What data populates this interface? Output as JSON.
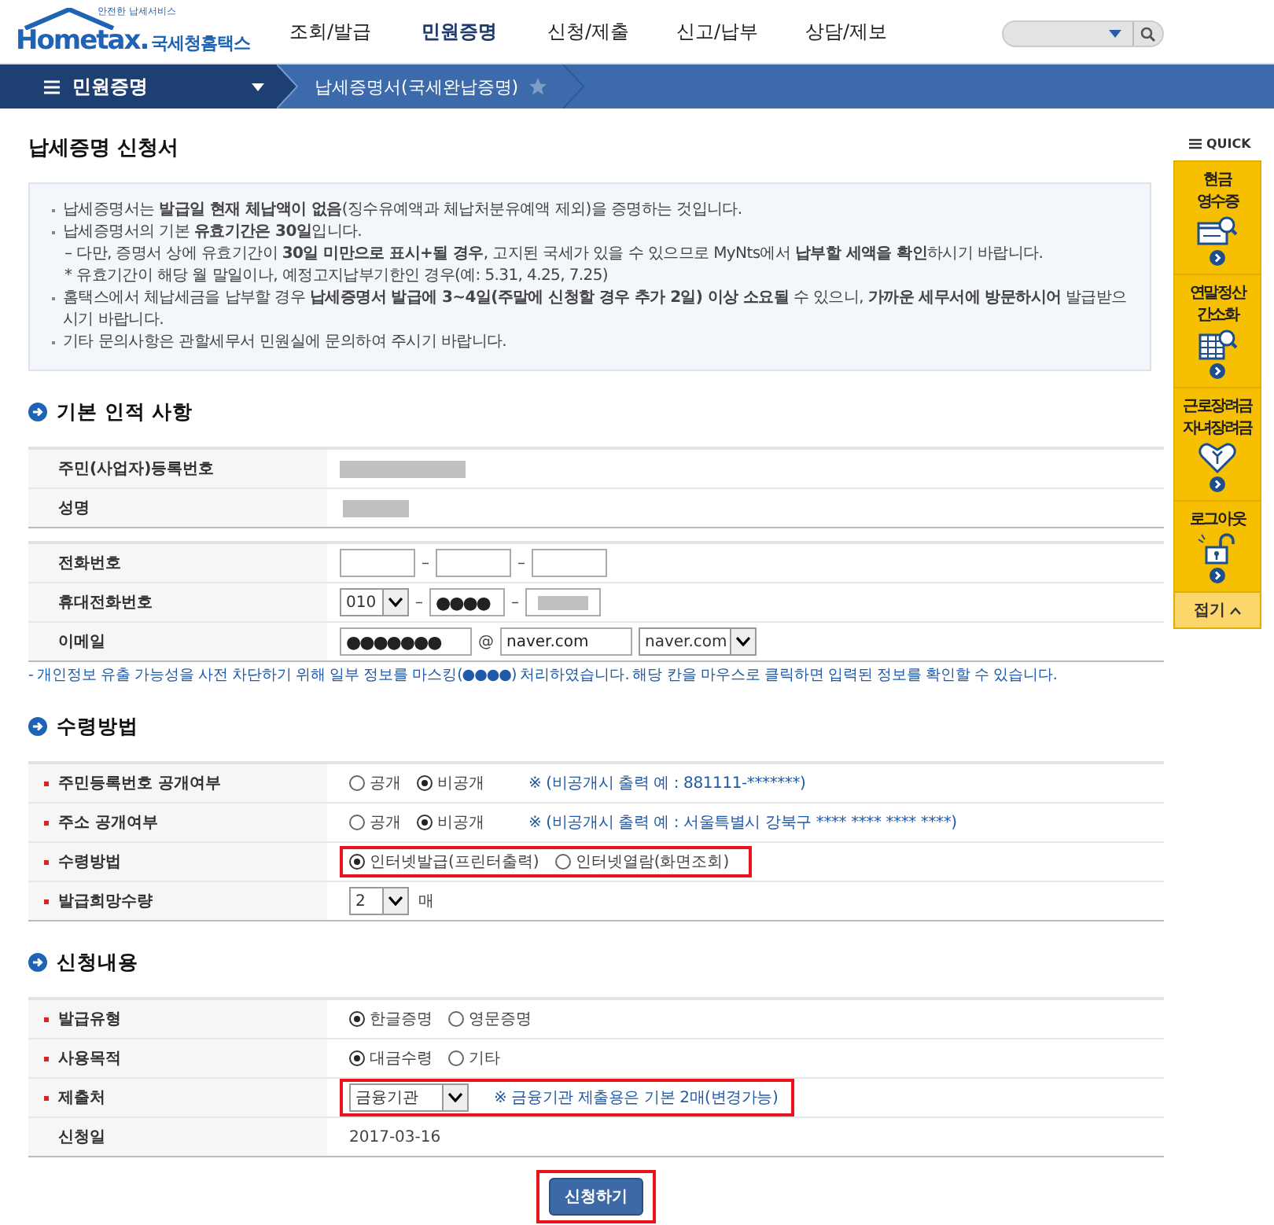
{
  "header": {
    "logo": {
      "tagline": "안전한 납세서비스",
      "brand": "Hometax.",
      "brand_kr": "국세청홈택스"
    },
    "nav": [
      {
        "label": "조회/발급",
        "selected": false
      },
      {
        "label": "민원증명",
        "selected": true
      },
      {
        "label": "신청/제출",
        "selected": false
      },
      {
        "label": "신고/납부",
        "selected": false
      },
      {
        "label": "상담/제보",
        "selected": false
      }
    ]
  },
  "breadcrumb": {
    "menu": "민원증명",
    "current": "납세증명서(국세완납증명)"
  },
  "page_title": "납세증명 신청서",
  "notice": [
    {
      "kind": "bullet",
      "text": "납세증명서는 **발급일 현재 체납액이 없음**(징수유예액과 체납처분유예액 제외)을 증명하는 것입니다."
    },
    {
      "kind": "bullet",
      "text": "납세증명서의 기본 **유효기간은 30일**입니다."
    },
    {
      "kind": "sub",
      "text": "– 다만, 증명서 상에 유효기간이 **30일 미만으로 표시+될 경우**, 고지된 국세가 있을 수 있으므로 MyNts에서 **납부할 세액을 확인**하시기 바랍니다."
    },
    {
      "kind": "sub",
      "text": "* 유효기간이 해당 월 말일이나, 예정고지납부기한인 경우(예: 5.31, 4.25, 7.25)"
    },
    {
      "kind": "bullet",
      "text": "홈택스에서 체납세금을 납부할 경우 **납세증명서 발급에 3~4일(주말에 신청할 경우 추가 2일) 이상 소요될** 수 있으니, **가까운 세무서에 방문하시어** 발급받으시기 바랍니다."
    },
    {
      "kind": "bullet",
      "text": "기타 문의사항은 관할세무서 민원실에 문의하여 주시기 바랍니다."
    }
  ],
  "sections": [
    {
      "title": "기본 인적 사항",
      "groups": [
        {
          "rows": [
            {
              "kind": "masked_long",
              "required": false,
              "label": "주민(사업자)등록번호"
            },
            {
              "kind": "masked_short",
              "required": false,
              "label": "성명"
            }
          ]
        },
        {
          "rows": [
            {
              "kind": "phone",
              "required": false,
              "label": "전화번호",
              "separator": "–"
            },
            {
              "kind": "mobile",
              "required": false,
              "label": "휴대전화번호",
              "select": "010",
              "separator": "–",
              "middle": "●●●●"
            },
            {
              "kind": "email",
              "required": false,
              "label": "이메일",
              "local": "●●●●●●●",
              "at": "@",
              "domain": "naver.com",
              "select": "naver.com"
            }
          ]
        }
      ],
      "note": "- 개인정보 유출 가능성을 사전 차단하기 위해 일부 정보를 마스킹(●●●●) 처리하였습니다. 해당 칸을 마우스로 클릭하면 입력된 정보를 확인할 수 있습니다."
    },
    {
      "title": "수령방법",
      "groups": [
        {
          "rows": [
            {
              "kind": "radio",
              "required": true,
              "label": "주민등록번호 공개여부",
              "highlighted": false,
              "options": [
                {
                  "label": "공개",
                  "selected": false
                },
                {
                  "label": "비공개",
                  "selected": true
                }
              ],
              "hint": "※ (비공개시 출력 예 : 881111-*******)"
            },
            {
              "kind": "radio",
              "required": true,
              "label": "주소 공개여부",
              "highlighted": false,
              "options": [
                {
                  "label": "공개",
                  "selected": false
                },
                {
                  "label": "비공개",
                  "selected": true
                }
              ],
              "hint": "※ (비공개시 출력 예 : 서울특별시 강북구 **** **** **** ****)"
            },
            {
              "kind": "radio",
              "required": true,
              "label": "수령방법",
              "highlighted": true,
              "options": [
                {
                  "label": "인터넷발급(프린터출력)",
                  "selected": true
                },
                {
                  "label": "인터넷열람(화면조회)",
                  "selected": false
                }
              ]
            },
            {
              "kind": "select",
              "required": true,
              "label": "발급희망수량",
              "highlighted": false,
              "value": "2",
              "suffix": "매"
            }
          ]
        }
      ]
    },
    {
      "title": "신청내용",
      "groups": [
        {
          "rows": [
            {
              "kind": "radio",
              "required": true,
              "label": "발급유형",
              "highlighted": false,
              "options": [
                {
                  "label": "한글증명",
                  "selected": true
                },
                {
                  "label": "영문증명",
                  "selected": false
                }
              ]
            },
            {
              "kind": "radio",
              "required": true,
              "label": "사용목적",
              "highlighted": false,
              "options": [
                {
                  "label": "대금수령",
                  "selected": true
                },
                {
                  "label": "기타",
                  "selected": false
                }
              ]
            },
            {
              "kind": "select",
              "required": true,
              "label": "제출처",
              "highlighted": true,
              "value": "금융기관",
              "hint": "※ 금융기관 제출용은 기본 2매(변경가능)"
            },
            {
              "kind": "text",
              "required": false,
              "label": "신청일",
              "value": "2017-03-16"
            }
          ]
        }
      ]
    }
  ],
  "submit": {
    "label": "신청하기",
    "highlighted": true
  },
  "quick": {
    "title": "QUICK",
    "items": [
      {
        "lines": [
          "현금",
          "영수증"
        ],
        "kind": "receipt"
      },
      {
        "lines": [
          "연말정산",
          "간소화"
        ],
        "kind": "table"
      },
      {
        "lines": [
          "근로장려금",
          "자녀장려금"
        ],
        "kind": "heart"
      },
      {
        "lines": [
          "로그아웃"
        ],
        "kind": "lock"
      }
    ],
    "close": "접기"
  }
}
